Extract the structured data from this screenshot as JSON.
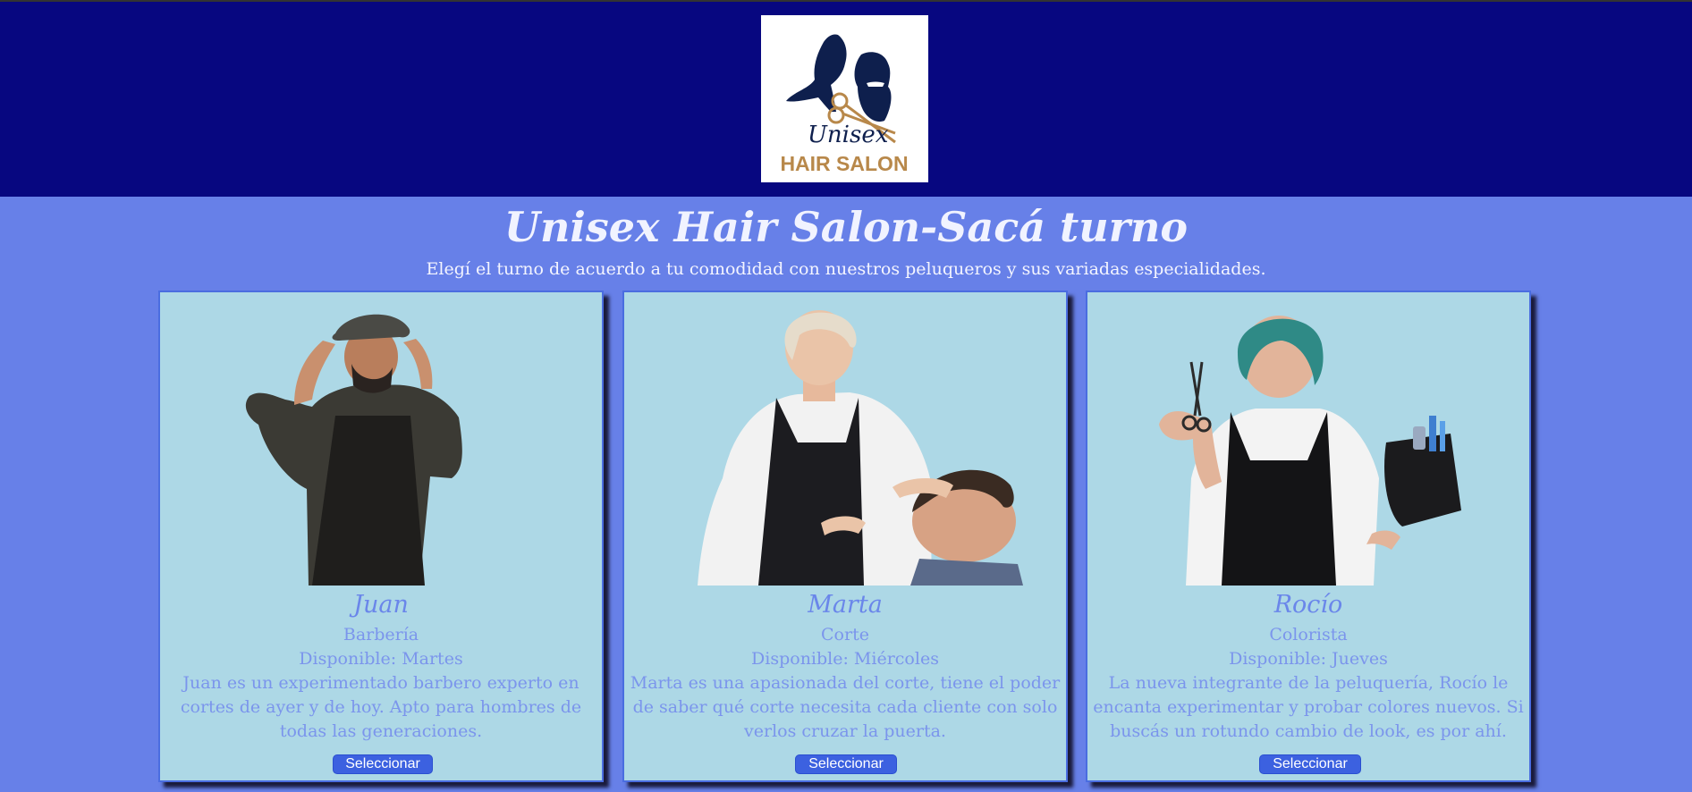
{
  "logo": {
    "line1": "Unisex",
    "line2": "HAIR SALON"
  },
  "page": {
    "title": "Unisex Hair Salon-Sacá turno",
    "subtitle": "Elegí el turno de acuerdo a tu comodidad con nuestros peluqueros y sus variadas especialidades."
  },
  "stylists": [
    {
      "name": "Juan",
      "specialty": "Barbería",
      "availability": "Disponible: Martes",
      "description": "Juan es un experimentado barbero experto en cortes de ayer y de hoy. Apto para hombres de todas las generaciones.",
      "button": "Seleccionar"
    },
    {
      "name": "Marta",
      "specialty": "Corte",
      "availability": "Disponible: Miércoles",
      "description": "Marta es una apasionada del corte, tiene el poder de saber qué corte necesita cada cliente con solo verlos cruzar la puerta.",
      "button": "Seleccionar"
    },
    {
      "name": "Rocío",
      "specialty": "Colorista",
      "availability": "Disponible: Jueves",
      "description": "La nueva integrante de la peluquería, Rocío le encanta experimentar y probar colores nuevos. Si buscás un rotundo cambio de look, es por ahí.",
      "button": "Seleccionar"
    }
  ],
  "colors": {
    "header_bg": "#070780",
    "page_bg": "#6780e8",
    "card_bg": "#add8e6",
    "button_bg": "#3c61e0",
    "logo_gold": "#b8884a",
    "logo_navy": "#0e1f4d"
  },
  "icons": {
    "logo": "salon-logo-icon",
    "scissors": "scissors-icon"
  }
}
